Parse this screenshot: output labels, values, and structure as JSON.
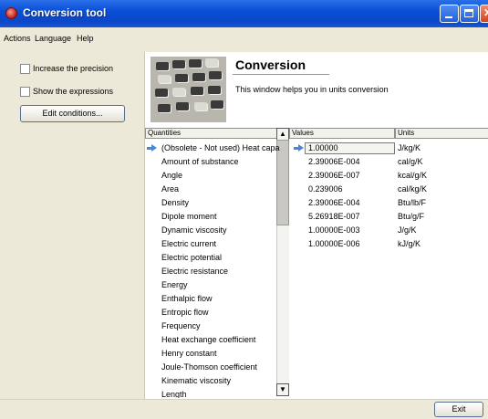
{
  "window": {
    "title": "Conversion tool"
  },
  "menu": [
    "Actions",
    "Language",
    "Help"
  ],
  "options": {
    "precision_label": "Increase the precision",
    "expressions_label": "Show the expressions",
    "edit_button": "Edit conditions..."
  },
  "header": {
    "title": "Conversion",
    "description": "This window helps you in units conversion"
  },
  "table": {
    "quantities_header": "Quantities",
    "values_header": "Values",
    "units_header": "Units",
    "quantities": [
      "(Obsolete - Not used) Heat capa",
      "Amount of substance",
      "Angle",
      "Area",
      "Density",
      "Dipole moment",
      "Dynamic viscosity",
      "Electric current",
      "Electric potential",
      "Electric resistance",
      "Energy",
      "Enthalpic flow",
      "Entropic flow",
      "Frequency",
      "Heat exchange coefficient",
      "Henry constant",
      "Joule-Thomson coefficient",
      "Kinematic viscosity",
      "Length"
    ],
    "values": [
      "1.00000",
      "2.39006E-004",
      "2.39006E-007",
      "0.239006",
      "2.39006E-004",
      "5.26918E-007",
      "1.00000E-003",
      "1.00000E-006"
    ],
    "units": [
      "J/kg/K",
      "cal/g/K",
      "kcal/g/K",
      "cal/kg/K",
      "Btu/lb/F",
      "Btu/g/F",
      "J/g/K",
      "kJ/g/K"
    ]
  },
  "footer": {
    "exit_button": "Exit"
  }
}
